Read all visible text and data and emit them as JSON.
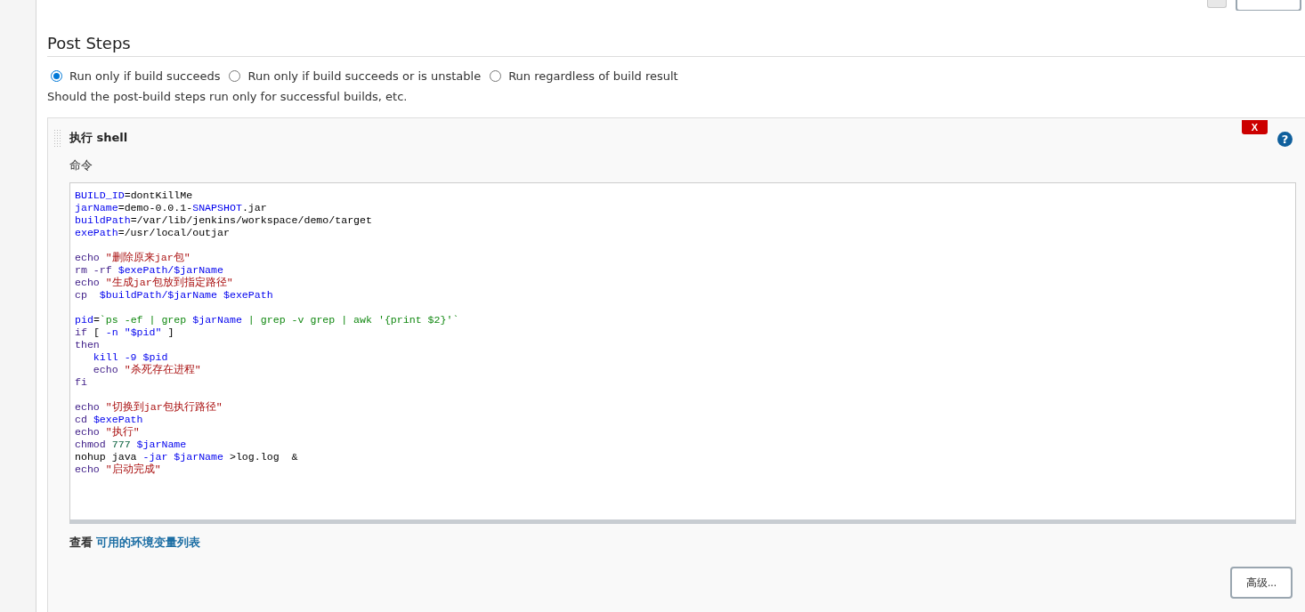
{
  "section": {
    "title": "Post Steps"
  },
  "run_conditions": [
    {
      "label": "Run only if build succeeds",
      "selected": true
    },
    {
      "label": "Run only if build succeeds or is unstable",
      "selected": false
    },
    {
      "label": "Run regardless of build result",
      "selected": false
    }
  ],
  "help_text": "Should the post-build steps run only for successful builds, etc.",
  "step": {
    "title": "执行 shell",
    "delete_label": "X",
    "help_label": "?",
    "command_label": "命令",
    "code_blocks": [
      [
        [
          {
            "text": "BUILD_ID",
            "kind": "var"
          },
          {
            "text": "=dontKillMe",
            "kind": "plain"
          }
        ],
        [
          {
            "text": "jarName",
            "kind": "var"
          },
          {
            "text": "=demo-0.0.1-",
            "kind": "plain"
          },
          {
            "text": "SNAPSHOT",
            "kind": "var"
          },
          {
            "text": ".jar",
            "kind": "plain"
          }
        ],
        [
          {
            "text": "buildPath",
            "kind": "var"
          },
          {
            "text": "=/var/lib/jenkins/workspace/demo/target",
            "kind": "plain"
          }
        ],
        [
          {
            "text": "exePath",
            "kind": "var"
          },
          {
            "text": "=/usr/local/outjar",
            "kind": "plain"
          }
        ]
      ],
      [
        [
          {
            "text": "echo ",
            "kind": "keyword"
          },
          {
            "text": "\"删除原来jar包\"",
            "kind": "string"
          }
        ],
        [
          {
            "text": "rm -rf ",
            "kind": "keyword"
          },
          {
            "text": "$exePath/$jarName",
            "kind": "var"
          }
        ],
        [
          {
            "text": "echo ",
            "kind": "keyword"
          },
          {
            "text": "\"生成jar包放到指定路径\"",
            "kind": "string"
          }
        ],
        [
          {
            "text": "cp  ",
            "kind": "keyword"
          },
          {
            "text": "$buildPath/$jarName $exePath",
            "kind": "var"
          }
        ]
      ],
      [
        [
          {
            "text": "pid",
            "kind": "var"
          },
          {
            "text": "=",
            "kind": "plain"
          },
          {
            "text": "`ps -ef | grep ",
            "kind": "command"
          },
          {
            "text": "$jarName",
            "kind": "var"
          },
          {
            "text": " | grep -v grep | awk '{print $2}'`",
            "kind": "command"
          }
        ],
        [
          {
            "text": "if",
            "kind": "keyword"
          },
          {
            "text": " [ ",
            "kind": "plain"
          },
          {
            "text": "-n ",
            "kind": "var"
          },
          {
            "text": "\"$pid\"",
            "kind": "var"
          },
          {
            "text": " ]",
            "kind": "plain"
          }
        ],
        [
          {
            "text": "then",
            "kind": "keyword"
          }
        ],
        [
          {
            "text": "   kill -9 $pid",
            "kind": "var"
          }
        ],
        [
          {
            "text": "   echo ",
            "kind": "keyword"
          },
          {
            "text": "\"杀死存在进程\"",
            "kind": "string"
          }
        ],
        [
          {
            "text": "fi",
            "kind": "keyword"
          }
        ]
      ],
      [
        [
          {
            "text": "echo ",
            "kind": "keyword"
          },
          {
            "text": "\"切换到jar包执行路径\"",
            "kind": "string"
          }
        ],
        [
          {
            "text": "cd ",
            "kind": "keyword"
          },
          {
            "text": "$exePath",
            "kind": "var"
          }
        ],
        [
          {
            "text": "echo ",
            "kind": "keyword"
          },
          {
            "text": "\"执行\"",
            "kind": "string"
          }
        ],
        [
          {
            "text": "chmod ",
            "kind": "keyword"
          },
          {
            "text": "777 ",
            "kind": "number"
          },
          {
            "text": "$jarName",
            "kind": "var"
          }
        ],
        [
          {
            "text": "nohup java ",
            "kind": "plain"
          },
          {
            "text": "-jar $jarName",
            "kind": "var"
          },
          {
            "text": " >log.log  &",
            "kind": "plain"
          }
        ],
        [
          {
            "text": "echo ",
            "kind": "keyword"
          },
          {
            "text": "\"启动完成\"",
            "kind": "string"
          }
        ]
      ]
    ],
    "env_prefix": "查看",
    "env_link": "可用的环境变量列表",
    "advanced_button": "高级..."
  }
}
